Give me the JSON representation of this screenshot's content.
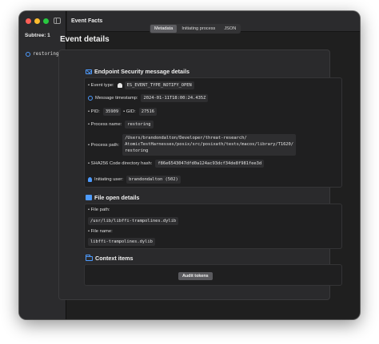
{
  "window": {
    "title": "Event Facts"
  },
  "sidebar": {
    "subtree_label": "Subtree: 1",
    "items": [
      {
        "label": "restoring",
        "icon": "circle-icon"
      }
    ]
  },
  "tabs": [
    {
      "label": "Metadata",
      "active": true
    },
    {
      "label": "Initiating process",
      "active": false
    },
    {
      "label": "JSON",
      "active": false
    }
  ],
  "page": {
    "title": "Event details"
  },
  "es_message": {
    "section_title": "Endpoint Security message details",
    "event_type_label": "• Event type:",
    "event_type_value": "ES_EVENT_TYPE_NOTIFY_OPEN",
    "timestamp_label": "Message timestamp:",
    "timestamp_value": "2024-01-11T18:00:24.435Z",
    "pid_label": "• PID:",
    "pid_value": "35909",
    "gid_label": "• GID:",
    "gid_value": "27516",
    "process_name_label": "• Process name:",
    "process_name_value": "restoring",
    "process_path_label": "• Process path:",
    "process_path_value": "/Users/brandondalton/Developer/threat-research/\nAtomicTestHarnesses/posix/src/posixath/tests/macos/library/T1620/\nrestoring",
    "sha_label": "• SHA256 Code directory hash:",
    "sha_value": "f86e6543047dfd0a124ac93dcf34de8f981fee3d",
    "user_label": "Initiating user:",
    "user_value": "brandondalton (502)"
  },
  "file_open": {
    "section_title": "File open details",
    "path_label": "• File path:",
    "path_value": "/usr/lib/libffi-trampolines.dylib",
    "name_label": "• File name:",
    "name_value": "libffi-trampolines.dylib"
  },
  "context": {
    "section_title": "Context items",
    "audit_button": "Audit tokens"
  },
  "colors": {
    "accent": "#4d9bff",
    "window_bg": "#1f1f1f",
    "panel_bg": "#2a2a2c"
  }
}
